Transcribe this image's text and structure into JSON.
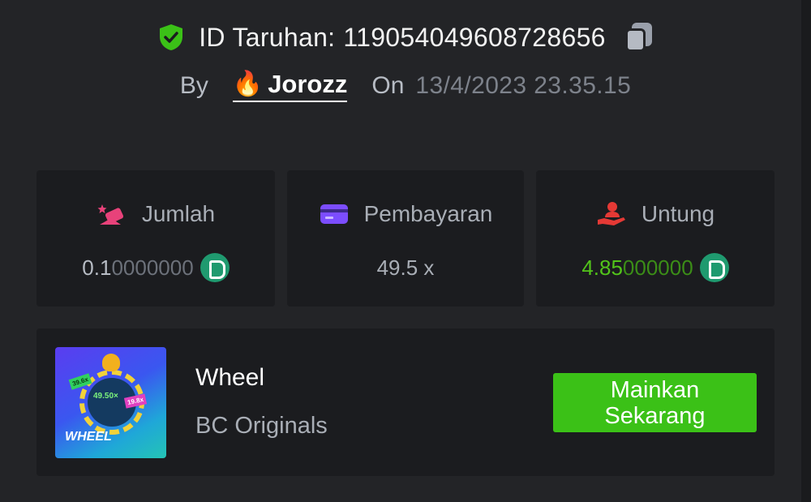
{
  "bet": {
    "label": "ID Taruhan:",
    "id": "119054049608728656"
  },
  "byline": {
    "by_label": "By",
    "user_emoji": "🔥",
    "username": "Jorozz",
    "on_label": "On",
    "date": "13/4/2023 23.35.15"
  },
  "stats": {
    "amount": {
      "label": "Jumlah",
      "value_main": "0.1",
      "value_dim": "0000000",
      "icon": "bet-amount-icon",
      "icon_color": "#e8427a"
    },
    "payout": {
      "label": "Pembayaran",
      "value": "49.5 x",
      "icon": "card-icon",
      "icon_color": "#7c4dff"
    },
    "profit": {
      "label": "Untung",
      "value_main": "4.85",
      "value_dim": "000000",
      "icon": "profit-hand-icon",
      "icon_color": "#e53935"
    }
  },
  "game": {
    "title": "Wheel",
    "provider": "BC Originals",
    "thumb_text": "WHEEL",
    "thumb_mult": "49.50×",
    "thumb_tag1": "39.6x",
    "thumb_tag2": "19.8x",
    "play_label": "Mainkan Sekarang"
  },
  "colors": {
    "accent_green": "#3bc117",
    "profit_green": "#52c41a",
    "coin": "#1f9a6f",
    "background": "#232427",
    "card": "#1b1c1f"
  }
}
